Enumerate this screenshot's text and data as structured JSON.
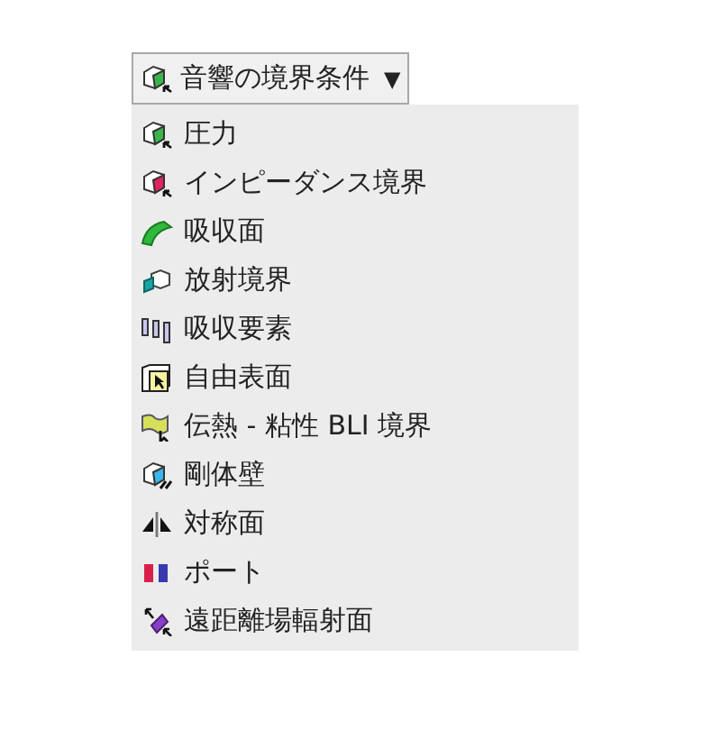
{
  "dropdown": {
    "label": "音響の境界条件",
    "caret": "▼"
  },
  "menu": {
    "items": [
      {
        "label": "圧力"
      },
      {
        "label": "インピーダンス境界"
      },
      {
        "label": "吸収面"
      },
      {
        "label": "放射境界"
      },
      {
        "label": "吸収要素"
      },
      {
        "label": "自由表面"
      },
      {
        "label": "伝熱 - 粘性 BLI 境界"
      },
      {
        "label": "剛体壁"
      },
      {
        "label": "対称面"
      },
      {
        "label": "ポート"
      },
      {
        "label": "遠距離場輻射面"
      }
    ]
  }
}
